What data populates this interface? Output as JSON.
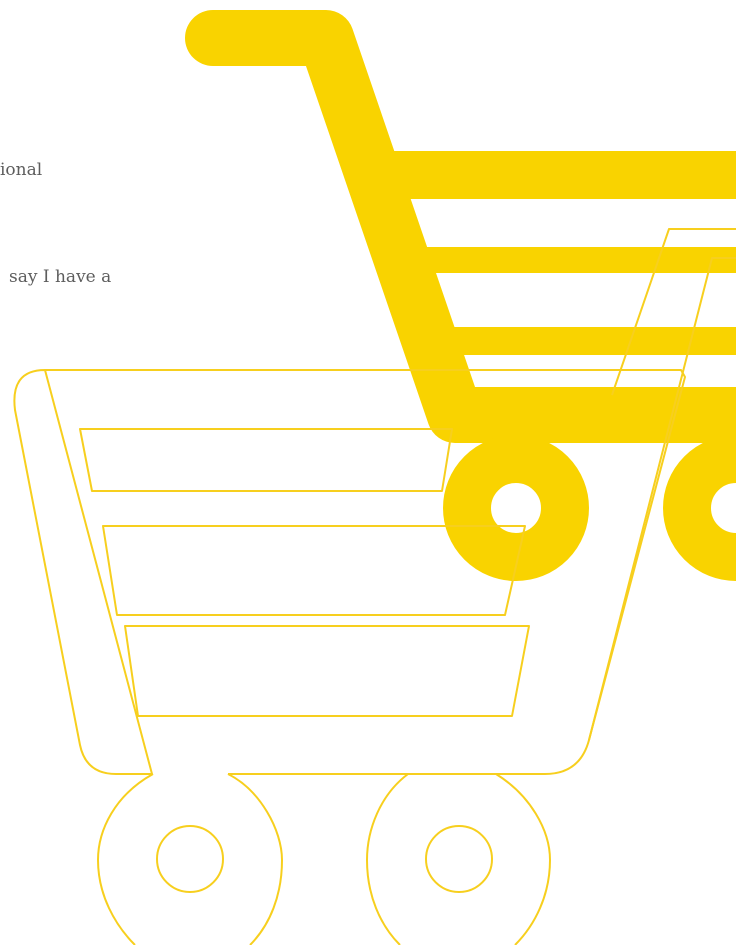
{
  "text_fragments": [
    "ional",
    "say I have a"
  ],
  "illustration": {
    "foreground_icon": "shopping-cart-outline-icon",
    "background_icon": "shopping-cart-filled-icon",
    "colors": {
      "cart_outline": "#f7cf1e",
      "cart_filled": "#f9d300",
      "text": "#5d5d5d",
      "background": "#ffffff"
    }
  }
}
